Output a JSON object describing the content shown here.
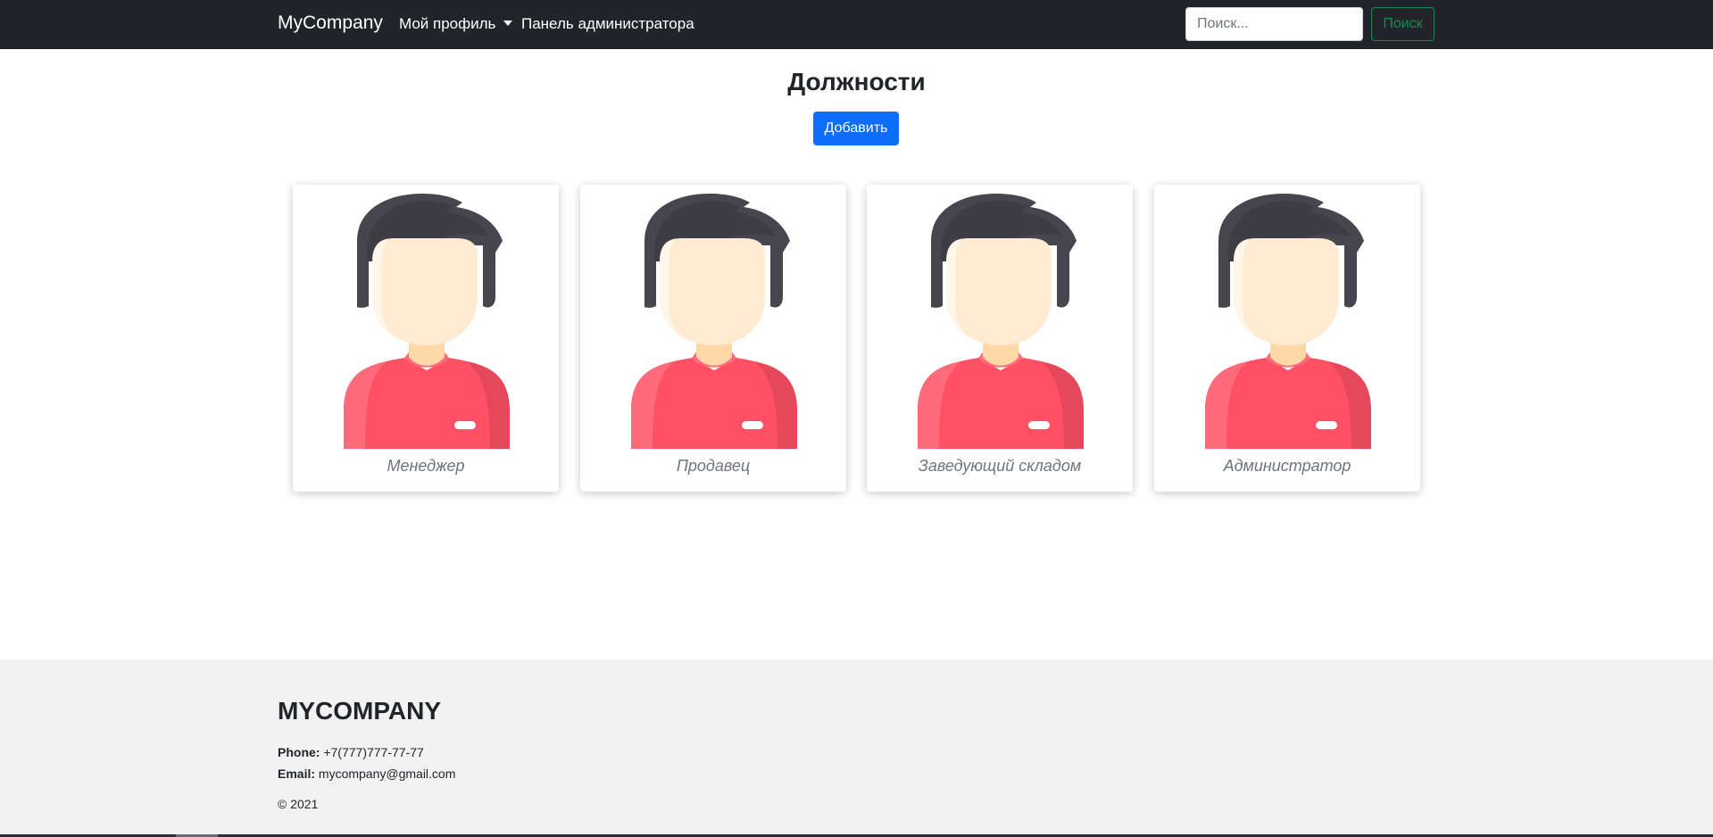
{
  "navbar": {
    "brand": "MyCompany",
    "profile_label": "Мой профиль",
    "admin_label": "Панель администратора",
    "search_placeholder": "Поиск...",
    "search_button": "Поиск"
  },
  "main": {
    "title": "Должности",
    "add_button": "Добавить",
    "positions": [
      {
        "label": "Менеджер",
        "icon": "person-avatar-icon"
      },
      {
        "label": "Продавец",
        "icon": "person-avatar-icon"
      },
      {
        "label": "Заведующий складом",
        "icon": "person-avatar-icon"
      },
      {
        "label": "Администратор",
        "icon": "person-avatar-icon"
      }
    ]
  },
  "footer": {
    "brand": "MYCOMPANY",
    "phone_label": "Phone:",
    "phone_value": "+7(777)777-77-77",
    "email_label": "Email:",
    "email_value": "mycompany@gmail.com",
    "copyright": "© 2021"
  },
  "colors": {
    "navbar_bg": "#212529",
    "primary": "#0d6efd",
    "success": "#198754",
    "footer_bg": "#f2f2f2",
    "avatar_hair": "#47464f",
    "avatar_skin": "#ffebd2",
    "avatar_shirt": "#ff5064"
  }
}
